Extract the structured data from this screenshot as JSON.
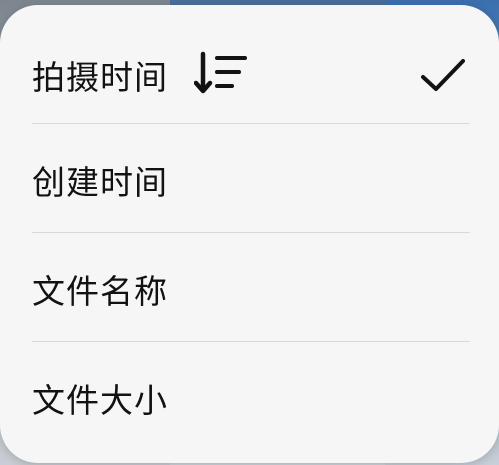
{
  "menu": {
    "items": [
      {
        "label": "拍摄时间",
        "selected": true,
        "sort_icon": "sort-descending-icon"
      },
      {
        "label": "创建时间",
        "selected": false
      },
      {
        "label": "文件名称",
        "selected": false
      },
      {
        "label": "文件大小",
        "selected": false
      }
    ],
    "check_icon": "checkmark-icon"
  },
  "colors": {
    "menu_background": "#f6f6f6",
    "text": "#121212",
    "divider": "#d9d9d9"
  }
}
